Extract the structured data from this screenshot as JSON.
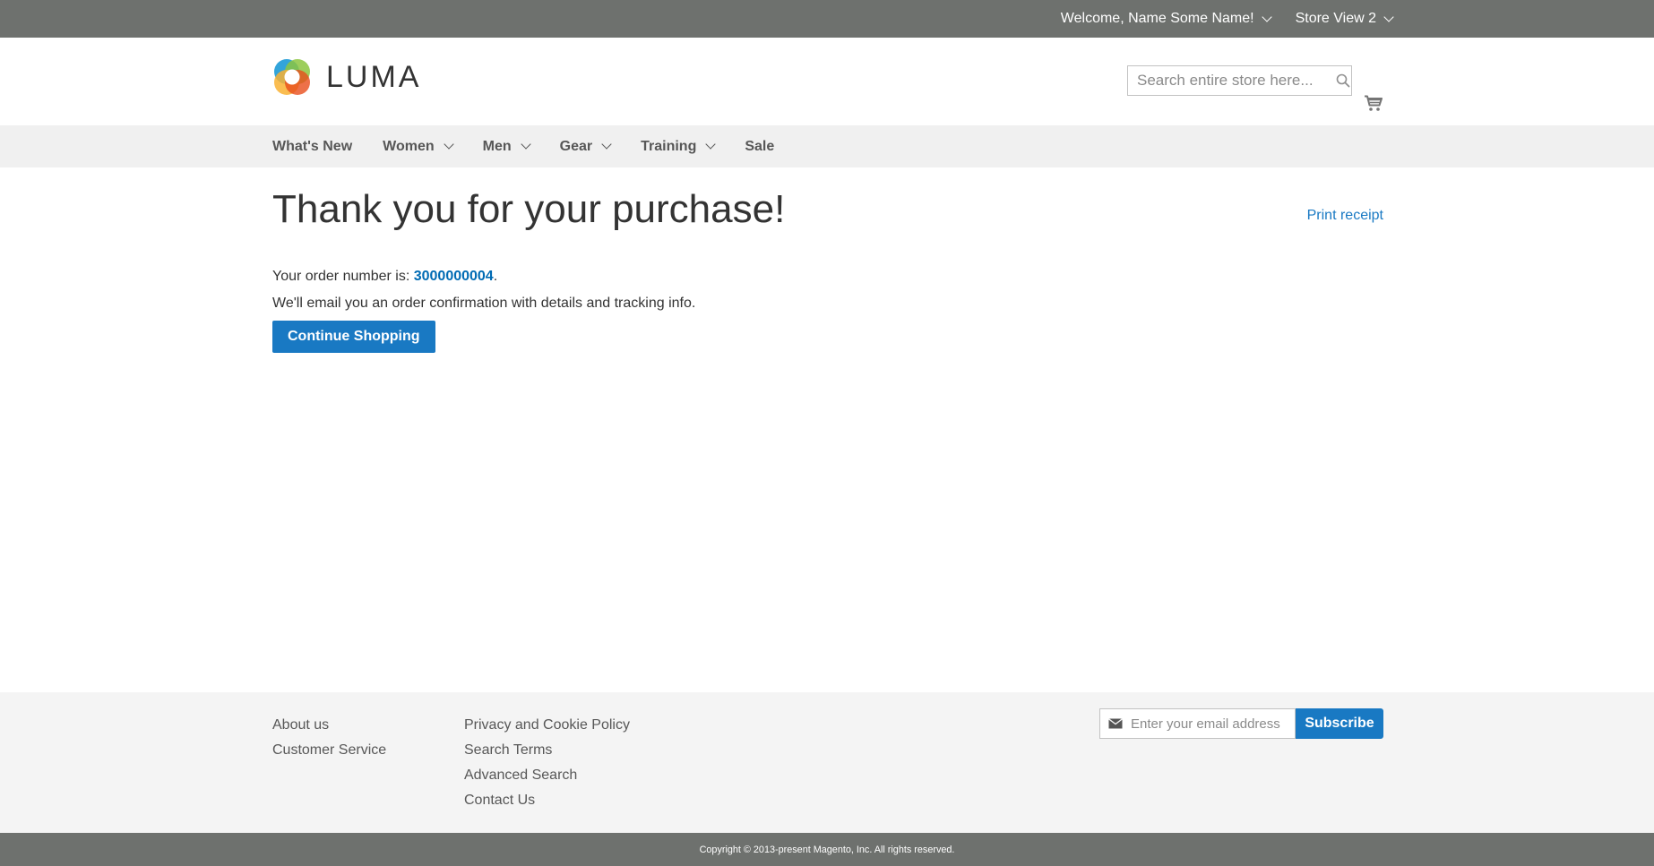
{
  "panel": {
    "welcome": "Welcome, Name Some Name!",
    "store_view": "Store View 2"
  },
  "header": {
    "logo_text": "LUMA",
    "search_placeholder": "Search entire store here..."
  },
  "nav": {
    "items": [
      {
        "label": "What's New",
        "has_children": false
      },
      {
        "label": "Women",
        "has_children": true
      },
      {
        "label": "Men",
        "has_children": true
      },
      {
        "label": "Gear",
        "has_children": true
      },
      {
        "label": "Training",
        "has_children": true
      },
      {
        "label": "Sale",
        "has_children": false
      }
    ]
  },
  "main": {
    "title": "Thank you for your purchase!",
    "print_receipt": "Print receipt",
    "order_prefix": "Your order number is: ",
    "order_number": "3000000004",
    "order_suffix": ".",
    "email_notice": "We'll email you an order confirmation with details and tracking info.",
    "continue_label": "Continue Shopping"
  },
  "footer": {
    "col1": [
      "About us",
      "Customer Service"
    ],
    "col2": [
      "Privacy and Cookie Policy",
      "Search Terms",
      "Advanced Search",
      "Contact Us"
    ],
    "newsletter_placeholder": "Enter your email address",
    "subscribe_label": "Subscribe"
  },
  "copyright": "Copyright © 2013-present Magento, Inc. All rights reserved.",
  "colors": {
    "header_bar": "#6e716e",
    "primary_button": "#1979c3",
    "link": "#006bb4",
    "nav_bg": "#f0f0f0",
    "footer_bg": "#f4f4f4"
  },
  "icons": [
    "luma-logo-icon",
    "search-icon",
    "cart-icon",
    "envelope-icon",
    "chevron-down-icon"
  ]
}
